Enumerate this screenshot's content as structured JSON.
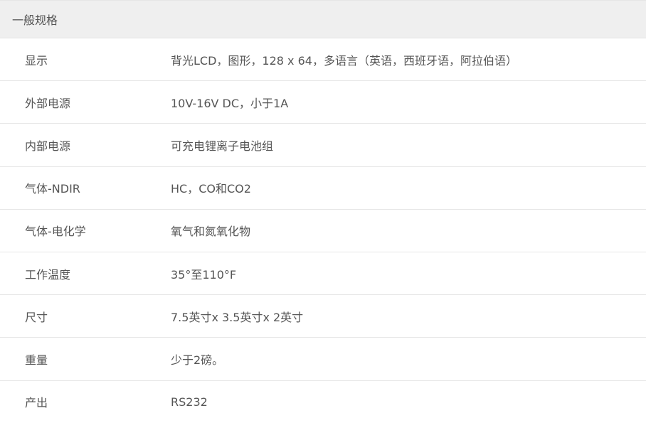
{
  "section": {
    "title": "一般规格"
  },
  "rows": [
    {
      "label": "显示",
      "value": "背光LCD，图形，128 x 64，多语言（英语，西班牙语，阿拉伯语）"
    },
    {
      "label": "外部电源",
      "value": "10V-16V DC，小于1A"
    },
    {
      "label": "内部电源",
      "value": "可充电锂离子电池组"
    },
    {
      "label": "气体-NDIR",
      "value": "HC，CO和CO2"
    },
    {
      "label": "气体-电化学",
      "value": "氧气和氮氧化物"
    },
    {
      "label": "工作温度",
      "value": "35°至110°F"
    },
    {
      "label": "尺寸",
      "value": "7.5英寸x 3.5英寸x 2英寸"
    },
    {
      "label": "重量",
      "value": "少于2磅。"
    },
    {
      "label": "产出",
      "value": "RS232"
    }
  ]
}
